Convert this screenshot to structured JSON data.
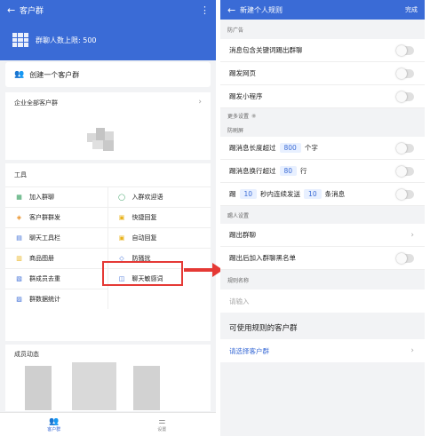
{
  "left": {
    "topbar": {
      "title": "客户群"
    },
    "banner": {
      "text": "群聊人数上限: 500"
    },
    "create": {
      "label": "创建一个客户群"
    },
    "corp": {
      "title": "企业全部客户群"
    },
    "tools": {
      "title": "工具",
      "items": [
        {
          "label": "加入群聊",
          "color": "#2e9b5a"
        },
        {
          "label": "入群欢迎语",
          "color": "#2e9b5a"
        },
        {
          "label": "客户群群发",
          "color": "#e88a1a"
        },
        {
          "label": "快捷回复",
          "color": "#e8b21a"
        },
        {
          "label": "聊天工具栏",
          "color": "#3a6bd6"
        },
        {
          "label": "自动回复",
          "color": "#e8b21a"
        },
        {
          "label": "商品图册",
          "color": "#e8b21a"
        },
        {
          "label": "防骚扰",
          "color": "#3a6bd6"
        },
        {
          "label": "群成员去重",
          "color": "#3a6bd6"
        },
        {
          "label": "聊天敏感词",
          "color": "#3a6bd6"
        },
        {
          "label": "群数据统计",
          "color": "#3a6bd6"
        }
      ]
    },
    "members": {
      "title": "成员动态"
    },
    "tabbar": {
      "tab1": "客户群",
      "tab2": "设置"
    }
  },
  "right": {
    "topbar": {
      "title": "新建个人规则",
      "done": "完成"
    },
    "section_ad": "防广告",
    "row_keyword": "消息包含关键词踢出群聊",
    "row_web": "踢发网页",
    "row_mini": "踢发小程序",
    "more_settings": "更多设置",
    "section_flood": "防刷屏",
    "flood1": {
      "a": "踢消息长度超过",
      "n": "800",
      "b": "个字"
    },
    "flood2": {
      "a": "踢消息换行超过",
      "n": "80",
      "b": "行"
    },
    "flood3": {
      "a": "踢",
      "n1": "10",
      "b": "秒内连续发送",
      "n2": "10",
      "c": "条消息"
    },
    "section_kick": "踢人设置",
    "row_kick": "踢出群聊",
    "row_blacklist": "踢出后加入群聊黑名单",
    "section_name": "规则名称",
    "name_placeholder": "请输入",
    "usable_title": "可使用规则的客户群",
    "select_group": "请选择客户群"
  }
}
